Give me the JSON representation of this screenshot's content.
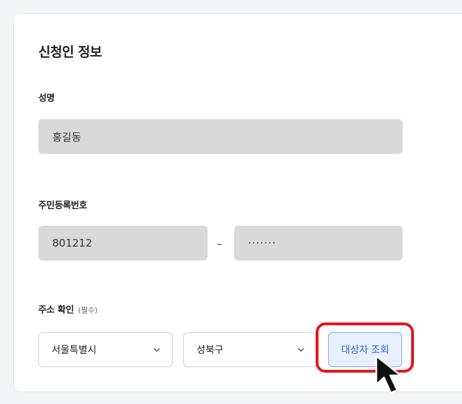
{
  "section": {
    "title": "신청인 정보"
  },
  "name": {
    "label": "성명",
    "value": "홍길동"
  },
  "rrn": {
    "label": "주민등록번호",
    "front": "801212",
    "separator": "–",
    "back": "·······"
  },
  "address": {
    "label": "주소 확인",
    "required_note": "(필수)",
    "city": {
      "selected": "서울특별시",
      "icon": "chevron-down-icon"
    },
    "district": {
      "selected": "성북구",
      "icon": "chevron-down-icon"
    },
    "query_button": "대상자 조회"
  },
  "colors": {
    "highlight": "#e8141b",
    "button_bg": "#e8f0fe",
    "button_text": "#2f63c8",
    "field_bg": "#d9d9d9"
  }
}
